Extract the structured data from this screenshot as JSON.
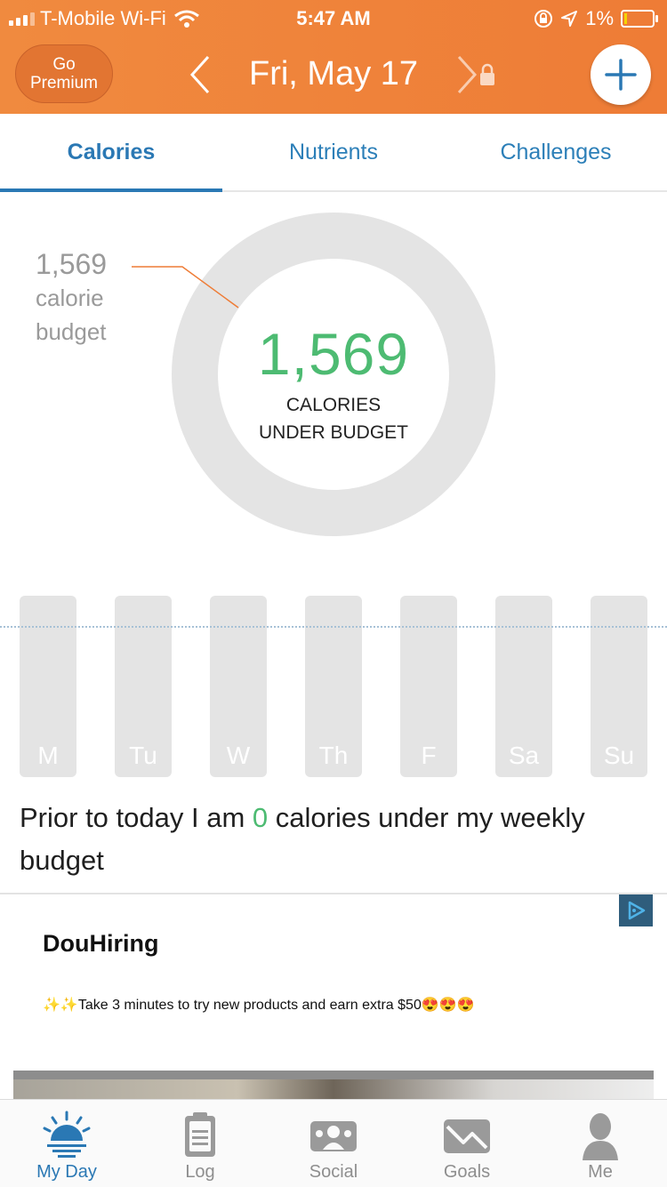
{
  "status_bar": {
    "carrier": "T-Mobile Wi-Fi",
    "time": "5:47 AM",
    "battery": "1%"
  },
  "header": {
    "premium_line1": "Go",
    "premium_line2": "Premium",
    "date": "Fri, May 17",
    "accent": "#ee7c36"
  },
  "tabs": [
    {
      "label": "Calories"
    },
    {
      "label": "Nutrients"
    },
    {
      "label": "Challenges"
    }
  ],
  "budget": {
    "value": "1,569",
    "line1": "calorie",
    "line2": "budget"
  },
  "ring": {
    "value": "1,569",
    "line1": "CALORIES",
    "line2": "UNDER BUDGET"
  },
  "week": {
    "days": [
      "M",
      "Tu",
      "W",
      "Th",
      "F",
      "Sa",
      "Su"
    ]
  },
  "prior": {
    "before": "Prior to today I am ",
    "value": "0",
    "after": " calories under my weekly budget"
  },
  "ad": {
    "title": "DouHiring",
    "text": "✨✨Take 3 minutes to try new products and earn extra $50😍😍😍"
  },
  "tabbar": [
    {
      "label": "My Day",
      "icon": "sunrise-icon"
    },
    {
      "label": "Log",
      "icon": "clipboard-icon"
    },
    {
      "label": "Social",
      "icon": "people-icon"
    },
    {
      "label": "Goals",
      "icon": "chart-icon"
    },
    {
      "label": "Me",
      "icon": "person-icon"
    }
  ]
}
